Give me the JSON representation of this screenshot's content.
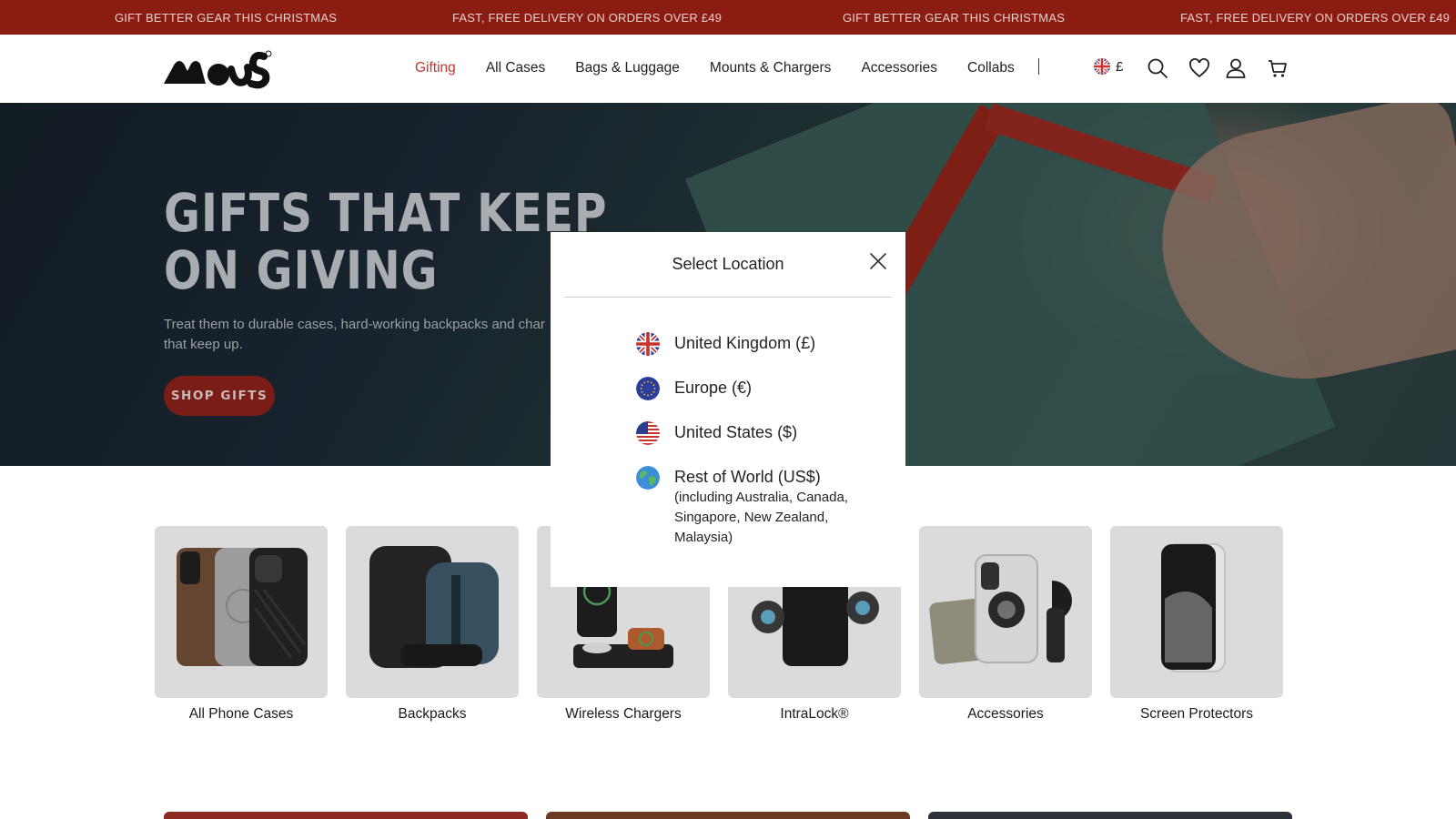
{
  "announcement": {
    "messages": [
      "GIFT BETTER GEAR THIS CHRISTMAS",
      "FAST, FREE DELIVERY ON ORDERS OVER £49",
      "GIFT BETTER GEAR THIS CHRISTMAS",
      "FAST, FREE DELIVERY ON ORDERS OVER £49"
    ]
  },
  "header": {
    "logo_text": "mous",
    "nav": [
      {
        "label": "Gifting",
        "active": true
      },
      {
        "label": "All Cases"
      },
      {
        "label": "Bags & Luggage"
      },
      {
        "label": "Mounts & Chargers"
      },
      {
        "label": "Accessories"
      },
      {
        "label": "Collabs"
      }
    ],
    "currency": "£",
    "icons": [
      "uk-flag-icon",
      "search-icon",
      "heart-icon",
      "account-icon",
      "cart-icon"
    ]
  },
  "hero": {
    "title_line1": "GIFTS THAT KEEP",
    "title_line2": "ON GIVING",
    "subtitle_line1": "Treat them to durable cases, hard-working backpacks and char",
    "subtitle_line2": "that keep up.",
    "cta": "SHOP GIFTS"
  },
  "categories": [
    {
      "label": "All Phone Cases"
    },
    {
      "label": "Backpacks"
    },
    {
      "label": "Wireless Chargers"
    },
    {
      "label": "IntraLock®"
    },
    {
      "label": "Accessories"
    },
    {
      "label": "Screen Protectors"
    }
  ],
  "modal": {
    "title": "Select Location",
    "locations": [
      {
        "label": "United Kingdom (£)",
        "flag": "uk-flag-icon"
      },
      {
        "label": "Europe (€)",
        "flag": "eu-flag-icon"
      },
      {
        "label": "United States ($)",
        "flag": "us-flag-icon"
      },
      {
        "label": "Rest of World (US$)",
        "flag": "globe-icon",
        "note": "(including Australia, Canada, Singapore, New Zealand, Malaysia)"
      }
    ]
  },
  "colors": {
    "announcement_bg": "#8a1c11",
    "accent_red": "#c8332a",
    "cta_bg": "#7a1d16"
  }
}
